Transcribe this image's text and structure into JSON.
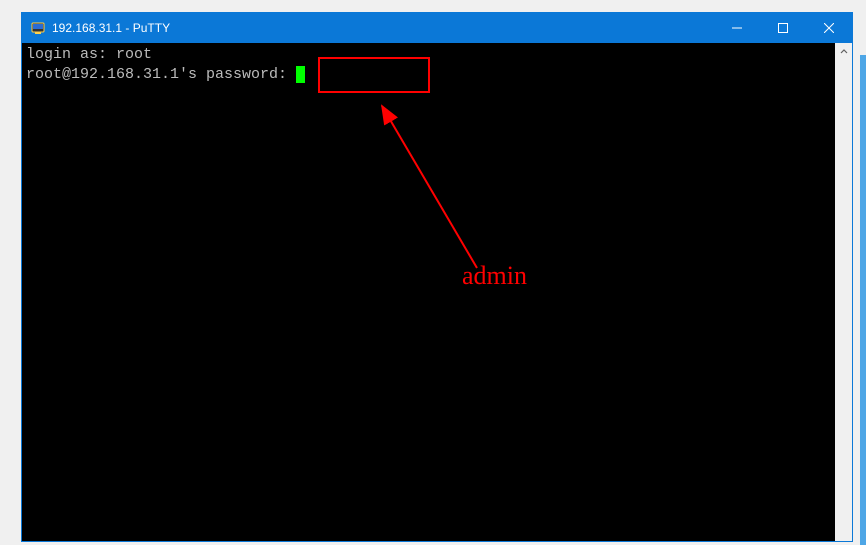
{
  "titlebar": {
    "title": "192.168.31.1 - PuTTY"
  },
  "terminal": {
    "lines": [
      "login as: root",
      "root@192.168.31.1's password: "
    ]
  },
  "annotation": {
    "label": "admin"
  }
}
